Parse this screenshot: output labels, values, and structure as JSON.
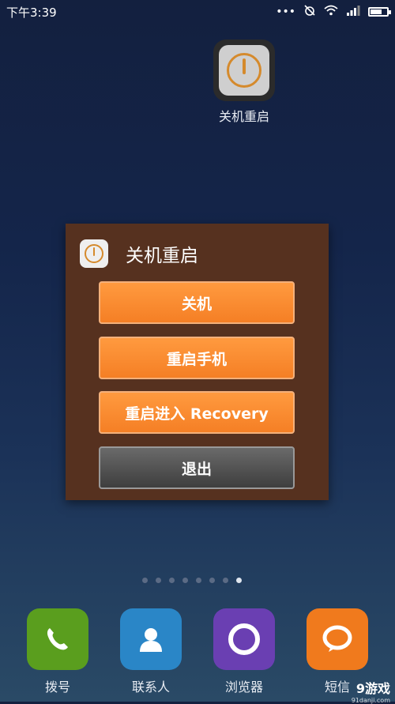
{
  "status_bar": {
    "time": "下午3:39",
    "icons": [
      "dots-icon",
      "alarm-off-icon",
      "wifi-icon",
      "signal-icon",
      "battery-icon"
    ],
    "battery_level": 0.8
  },
  "desktop_app": {
    "label": "关机重启",
    "icon": "power-icon"
  },
  "dialog": {
    "title": "关机重启",
    "buttons": [
      {
        "label": "关机",
        "style": "orange"
      },
      {
        "label": "重启手机",
        "style": "orange"
      },
      {
        "label": "重启进入 Recovery",
        "style": "orange"
      },
      {
        "label": "退出",
        "style": "gray"
      }
    ]
  },
  "page_indicator": {
    "count": 8,
    "active_index": 7
  },
  "dock": {
    "items": [
      {
        "label": "拨号",
        "icon": "phone-icon",
        "color": "#5a9e1e"
      },
      {
        "label": "联系人",
        "icon": "contact-icon",
        "color": "#2a86c7"
      },
      {
        "label": "浏览器",
        "icon": "browser-icon",
        "color": "#6a3fb2"
      },
      {
        "label": "短信",
        "icon": "message-icon",
        "color": "#f07a1d"
      }
    ]
  },
  "watermark": {
    "brand": "9游戏",
    "site": "91danji.com"
  },
  "colors": {
    "dialog_bg": "#56311f",
    "button_orange": "#f57f25",
    "button_gray": "#4a4a4a",
    "power_accent": "#d58a2c"
  }
}
